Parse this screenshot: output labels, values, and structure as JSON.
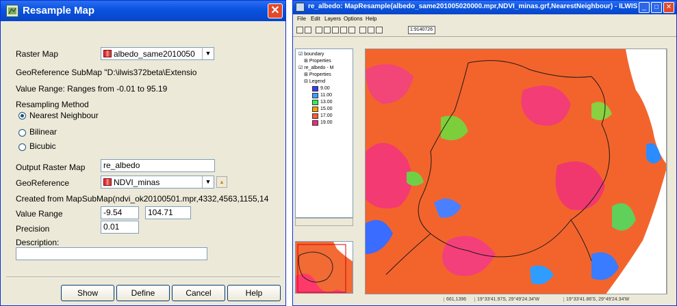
{
  "dialog": {
    "title": "Resample Map",
    "raster_map_label": "Raster Map",
    "raster_map_value": "albedo_same2010050",
    "georef_info": "GeoReference SubMap \"D:\\ilwis372beta\\Extensio",
    "value_range_info": "Value Range: Ranges from  -0.01 to  95.19",
    "method_label": "Resampling Method",
    "methods": [
      "Nearest Neighbour",
      "Bilinear",
      "Bicubic"
    ],
    "selected_method": "Nearest Neighbour",
    "output_label": "Output Raster Map",
    "output_value": "re_albedo",
    "georef_label": "GeoReference",
    "georef_value": "NDVI_minas",
    "created_from": "Created from MapSubMap(ndvi_ok20100501.mpr,4332,4563,1155,14",
    "value_range_label": "Value Range",
    "value_range_min": "-9.54",
    "value_range_max": "104.71",
    "precision_label": "Precision",
    "precision_value": "0.01",
    "description_label": "Description:",
    "description_value": "",
    "buttons": {
      "show": "Show",
      "define": "Define",
      "cancel": "Cancel",
      "help": "Help"
    },
    "close_icon": "close-icon",
    "accent": "#0a52e0"
  },
  "map_window": {
    "title": "re_albedo: MapResample(albedo_same201005020000.mpr,NDVI_minas.grf,NearestNeighbour) - ILWIS",
    "menu": [
      "File",
      "Edit",
      "Layers",
      "Options",
      "Help"
    ],
    "scale": "1:9140726",
    "layers": [
      {
        "name": "boundary",
        "children": [
          "Properties"
        ]
      },
      {
        "name": "re_albedo - M",
        "children": [
          "Properties",
          "Legend"
        ]
      }
    ],
    "legend": [
      {
        "label": "9.00",
        "color": "#3a3aff"
      },
      {
        "label": "11.00",
        "color": "#3aa0ff"
      },
      {
        "label": "13.00",
        "color": "#33ee55"
      },
      {
        "label": "15.00",
        "color": "#ff9a00"
      },
      {
        "label": "17.00",
        "color": "#ff5a30"
      },
      {
        "label": "19.00",
        "color": "#f0287a"
      }
    ],
    "status": [
      "661,1396",
      "19°33'41.97S, 29°49'24.34'W",
      "19°33'41.86'S, 29°49'24.34'W"
    ]
  }
}
